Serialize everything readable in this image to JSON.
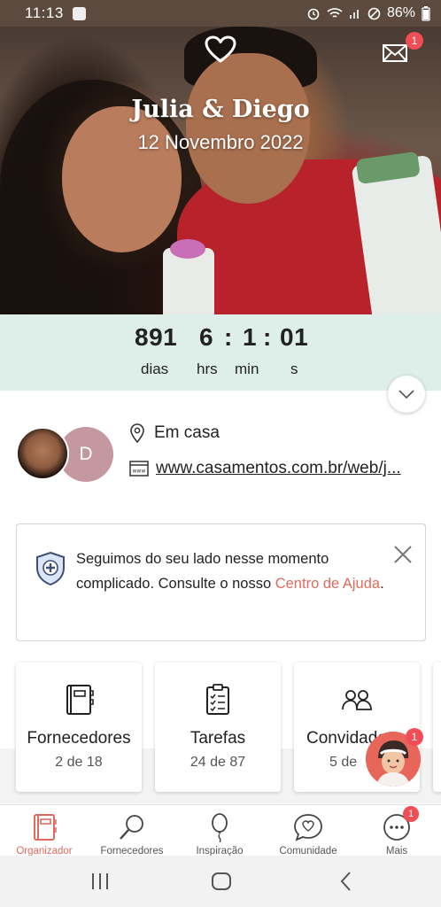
{
  "status_bar": {
    "time": "11:13",
    "battery": "86%"
  },
  "hero": {
    "couple_names": "Julia & Diego",
    "wedding_date": "12 Novembro 2022",
    "inbox_badge": "1"
  },
  "countdown": {
    "days": "891",
    "hours": "6",
    "minutes": "1",
    "seconds": "01",
    "days_label": "dias",
    "hours_label": "hrs",
    "minutes_label": "min",
    "seconds_label": "s"
  },
  "details": {
    "avatar_initial": "D",
    "location": "Em casa",
    "website": "www.casamentos.com.br/web/j..."
  },
  "alert": {
    "text_before": "Seguimos do seu lado nesse momento complicado. Consulte o nosso ",
    "link_text": "Centro de Ajuda",
    "text_after": "."
  },
  "cards": [
    {
      "name": "Fornecedores",
      "count": "2 de 18",
      "icon": "notebook-icon"
    },
    {
      "name": "Tarefas",
      "count": "24 de 87",
      "icon": "checklist-icon"
    },
    {
      "name": "Convidados",
      "count": "5 de",
      "icon": "guests-icon"
    }
  ],
  "assistant_badge": "1",
  "bottom_nav": [
    {
      "label": "Organizador",
      "icon": "organizer-icon",
      "active": true
    },
    {
      "label": "Fornecedores",
      "icon": "magnifier-icon",
      "active": false
    },
    {
      "label": "Inspiração",
      "icon": "balloon-icon",
      "active": false
    },
    {
      "label": "Comunidade",
      "icon": "chat-heart-icon",
      "active": false
    },
    {
      "label": "Mais",
      "icon": "more-icon",
      "active": false
    }
  ],
  "more_badge": "1",
  "colors": {
    "accent": "#e06a5e",
    "badge": "#f04d57",
    "countdown_bg": "#deefe9",
    "status_bar": "#5b4a3d"
  }
}
